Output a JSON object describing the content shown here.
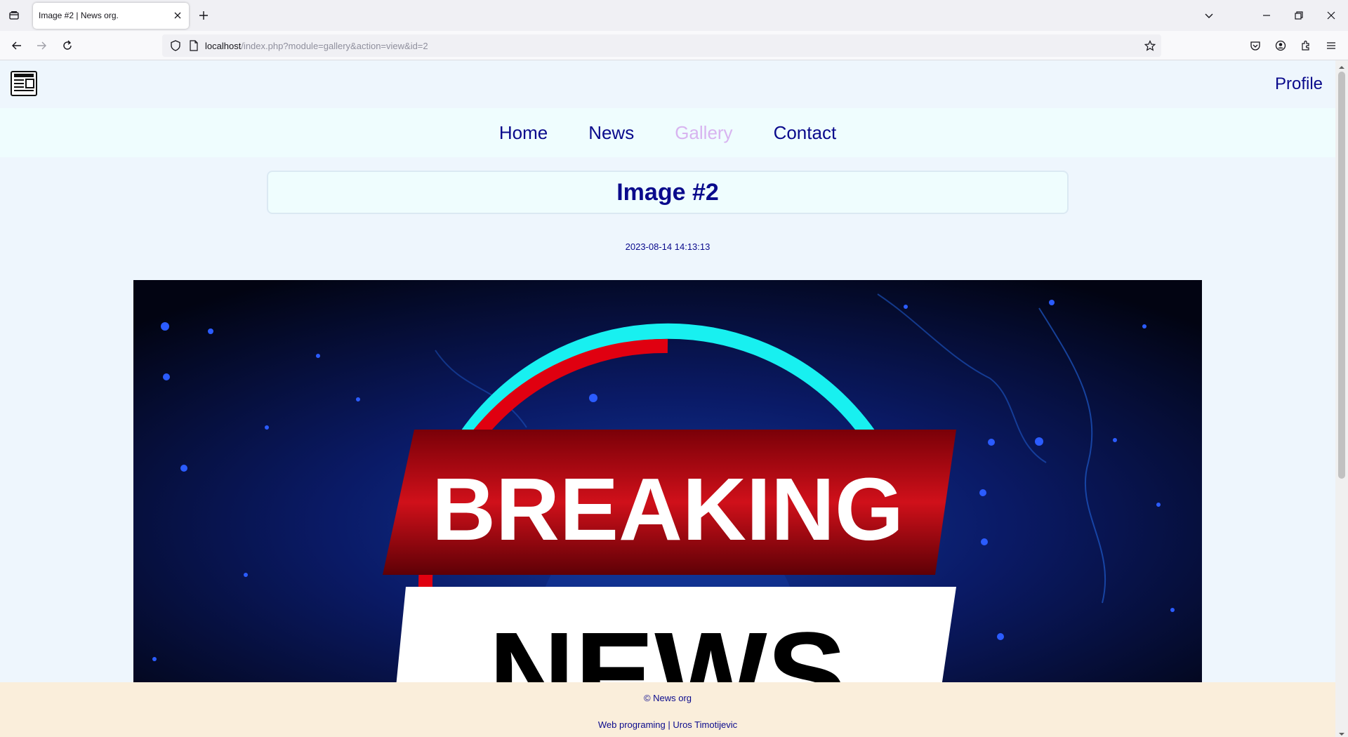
{
  "browser": {
    "tab_title": "Image #2 | News org.",
    "url_host": "localhost",
    "url_path": "/index.php?module=gallery&action=view&id=2"
  },
  "site": {
    "profile_label": "Profile",
    "menu": [
      "Home",
      "News",
      "Gallery",
      "Contact"
    ],
    "active_menu": "Gallery"
  },
  "gallery": {
    "title": "Image #2",
    "date": "2023-08-14 14:13:13",
    "image_text_top": "BREAKING",
    "image_text_bottom": "NEWS"
  },
  "footer": {
    "copyright": "© News org",
    "credit": "Web programing | Uros Timotijevic"
  },
  "colors": {
    "link": "#0a0a8c",
    "active_link": "#d8b4f0",
    "footer_bg": "#faeedb",
    "page_bg": "#eef6fd"
  }
}
